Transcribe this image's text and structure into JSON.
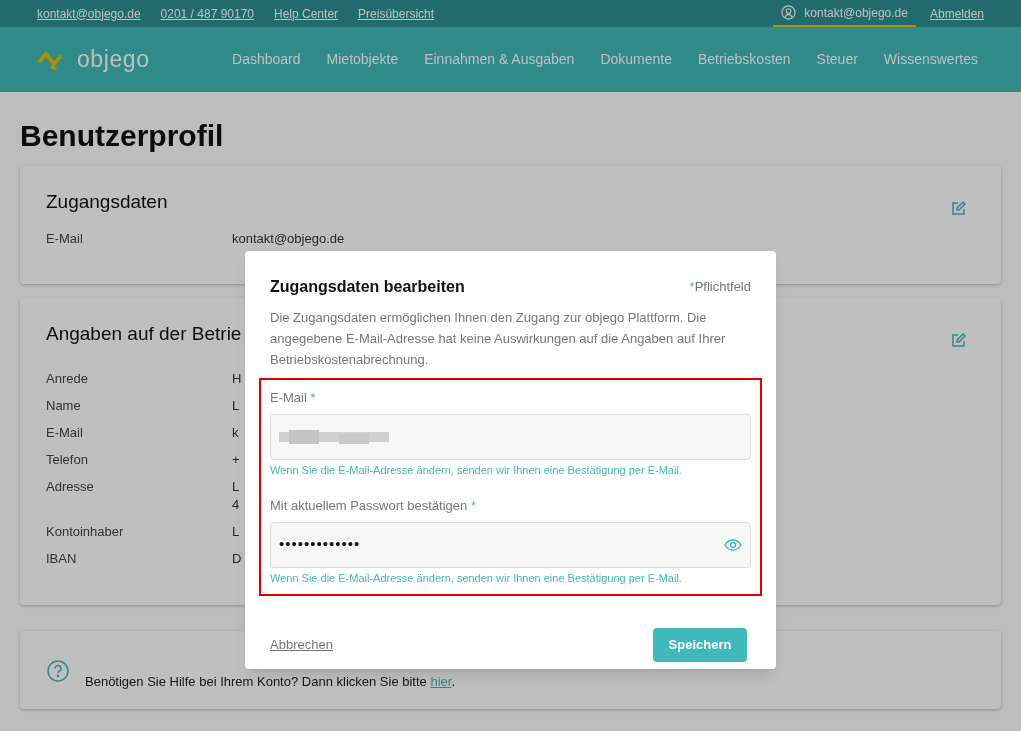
{
  "top_bar": {
    "links": [
      "kontakt@objego.de",
      "0201 / 487 90170",
      "Help Center",
      "Preisübersicht"
    ],
    "account": "kontakt@objego.de",
    "logout": "Abmelden"
  },
  "nav": {
    "logo": "objego",
    "items": [
      {
        "label": "Dashboard",
        "selected": false
      },
      {
        "label": "Mietobjekte",
        "selected": false
      },
      {
        "label": "Einnahmen & Ausgaben",
        "selected": false
      },
      {
        "label": "Dokumente",
        "selected": false
      },
      {
        "label": "Betriebskosten",
        "selected": false
      },
      {
        "label": "Steuer",
        "selected": false
      },
      {
        "label": "Wissenswertes",
        "selected": false
      }
    ]
  },
  "page_title": "Benutzerprofil",
  "cards": [
    {
      "title": "Zugangsdaten",
      "rows": [
        {
          "label": "E-Mail",
          "values": [
            "kontakt@objego.de"
          ]
        }
      ]
    },
    {
      "title": "Angaben auf der Betrie",
      "rows": [
        {
          "label": "Anrede",
          "values": [
            "H"
          ]
        },
        {
          "label": "Name",
          "values": [
            "L"
          ]
        },
        {
          "label": "E-Mail",
          "values": [
            "k"
          ]
        },
        {
          "label": "Telefon",
          "values": [
            "+"
          ]
        },
        {
          "label": "Adresse",
          "values": [
            "L",
            "4"
          ]
        },
        {
          "label": "Kontoinhaber",
          "values": [
            "L"
          ]
        },
        {
          "label": "IBAN",
          "values": [
            "D"
          ]
        }
      ]
    }
  ],
  "help": {
    "text": "Benötigen Sie Hilfe bei Ihrem Konto? Dann klicken Sie bitte",
    "link": "hier",
    "end": "."
  },
  "dialog": {
    "title": "Zugangsdaten bearbeiten",
    "required_mark": "*",
    "required_note": "Pflichtfeld",
    "description": "Die Zugangsdaten ermöglichen Ihnen den Zugang zur objego Plattform. Die angegebene E-Mail-Adresse hat keine Auswirkungen auf die Angaben auf Ihrer Betriebskostenabrechnung.",
    "fields": [
      {
        "kind": "email",
        "label": "E-Mail",
        "required_mark": "*",
        "hint": "Wenn Sie die E-Mail-Adresse ändern, senden wir Ihnen eine Bestätigung per E-Mail."
      },
      {
        "kind": "password",
        "label": "Mit aktuellem Passwort bestätigen",
        "required_mark": "*",
        "value": "•••••••••••••",
        "hint": "Wenn Sie die E-Mail-Adresse ändern, senden wir Ihnen eine Bestätigung per E-Mail."
      }
    ],
    "cancel": "Abbrechen",
    "save": "Speichern"
  }
}
